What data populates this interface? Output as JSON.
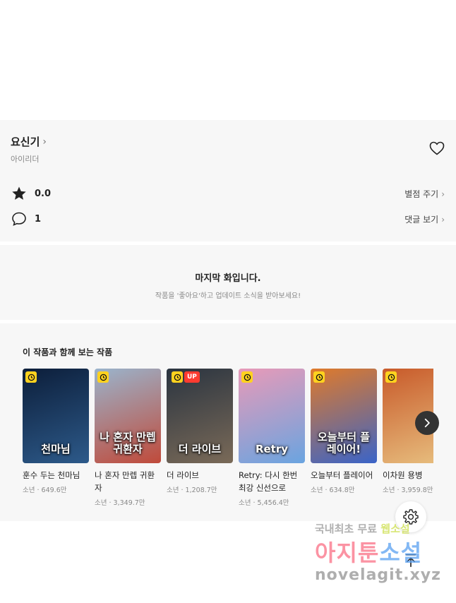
{
  "work": {
    "title": "요신기",
    "author": "아이리더",
    "rating": "0.0",
    "comment_count": "1",
    "rate_label": "별점 주기",
    "comments_label": "댓글 보기"
  },
  "notice": {
    "title": "마지막 화입니다.",
    "subtitle": "작품을 '좋아요'하고 업데이트 소식을 받아보세요!"
  },
  "recommendations": {
    "heading": "이 작품과 함께 보는 작품",
    "items": [
      {
        "title": "훈수 두는 천마님",
        "meta": "소년 · 649.6만",
        "cover_text": "천마님",
        "badge": "clock",
        "colors": [
          "#0c1e3a",
          "#2d5a8a"
        ]
      },
      {
        "title": "나 혼자 만렙 귀환자",
        "meta": "소년 · 3,349.7만",
        "cover_text": "나 혼자 만렙 귀환자",
        "badge": "clock",
        "colors": [
          "#9ab4cc",
          "#c04a3a"
        ]
      },
      {
        "title": "더 라이브",
        "meta": "소년 · 1,208.7만",
        "cover_text": "더 라이브",
        "badge": "clock",
        "up_label": "UP",
        "colors": [
          "#2a3440",
          "#7a6a58"
        ]
      },
      {
        "title": "Retry: 다시 한번 최강 신선으로",
        "meta": "소년 · 5,456.4만",
        "cover_text": "Retry",
        "badge": "clock",
        "colors": [
          "#e89ab8",
          "#6aa4e0"
        ]
      },
      {
        "title": "오늘부터 플레이어",
        "meta": "소년 · 634.8만",
        "cover_text": "오늘부터 플레이어!",
        "badge": "clock",
        "colors": [
          "#e07a2a",
          "#3a64c8"
        ]
      },
      {
        "title": "이차원 용병",
        "meta": "소년 · 3,959.8만",
        "cover_text": "",
        "badge": "clock",
        "colors": [
          "#c85a2a",
          "#e8c080"
        ]
      }
    ]
  },
  "watermark": {
    "line1_a": "국내최초 무료",
    "line1_b": "웹소설",
    "line2_a": "아지툰",
    "line2_b": "소설",
    "line3": "novelagit.xyz"
  },
  "icons": {
    "title_chevron": "chevron-right-icon",
    "like": "heart-icon",
    "rating": "star-icon",
    "comments": "speech-bubble-icon",
    "next": "chevron-right-icon",
    "settings": "gear-icon",
    "scroll_top": "arrow-up-icon"
  }
}
